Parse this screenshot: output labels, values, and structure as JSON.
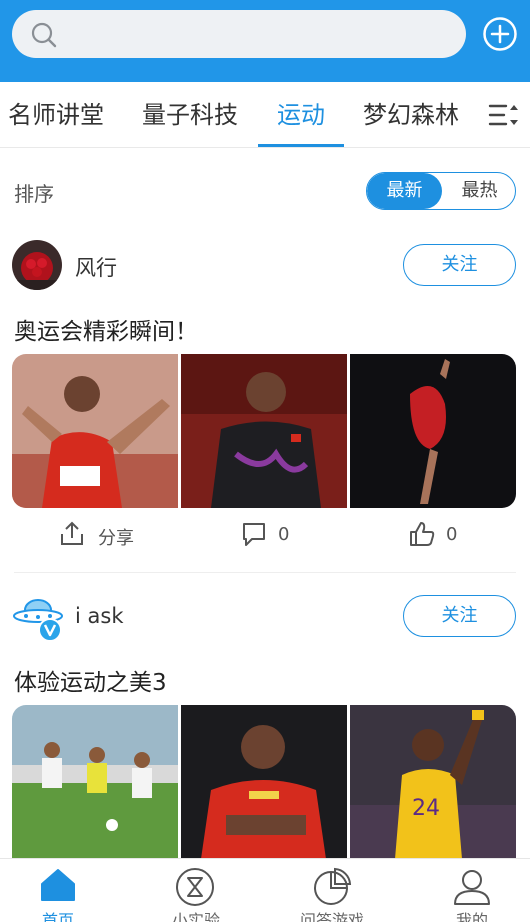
{
  "search": {
    "placeholder": ""
  },
  "tabs": [
    {
      "label": "名师讲堂"
    },
    {
      "label": "量子科技"
    },
    {
      "label": "运动",
      "active": true
    },
    {
      "label": "梦幻森林"
    }
  ],
  "sort": {
    "label": "排序",
    "options": [
      "最新",
      "最热"
    ],
    "selected": "最新"
  },
  "posts": [
    {
      "author": "风行",
      "follow_label": "关注",
      "title": "奥运会精彩瞬间！",
      "share_label": "分享",
      "comments": "0",
      "likes": "0"
    },
    {
      "author": "i ask",
      "follow_label": "关注",
      "title": "体验运动之美3"
    }
  ],
  "bottom_nav": [
    {
      "label": "首页",
      "icon": "home-icon",
      "active": true
    },
    {
      "label": "小实验",
      "icon": "hourglass-icon"
    },
    {
      "label": "问答游戏",
      "icon": "pie-chart-icon"
    },
    {
      "label": "我的",
      "icon": "user-icon"
    }
  ],
  "colors": {
    "brand": "#2196e8",
    "accent": "#1e90e0"
  }
}
